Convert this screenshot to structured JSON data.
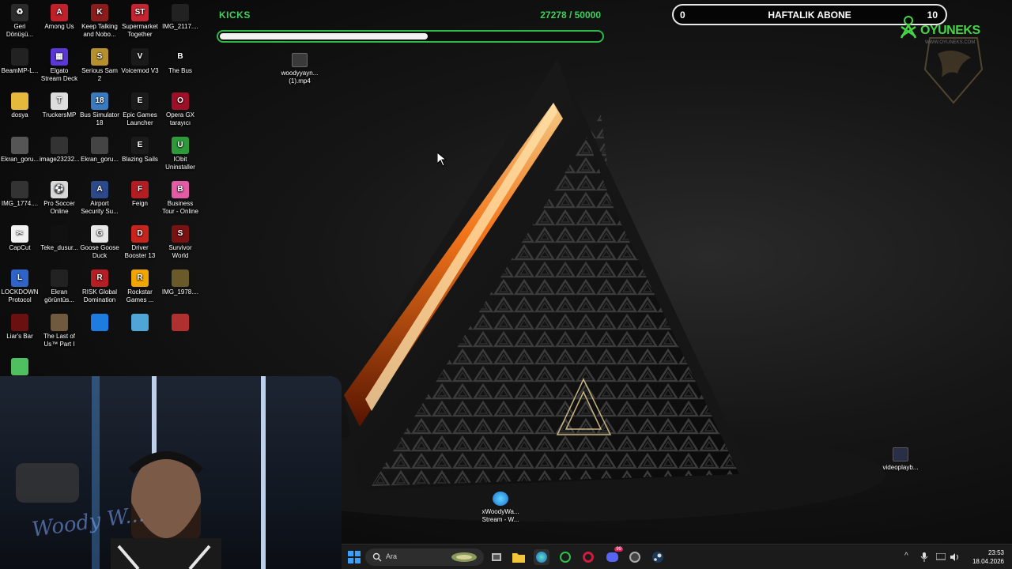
{
  "overlay": {
    "kicks": {
      "title": "KICKS",
      "count": "27278 / 50000",
      "progress": 0.5456
    },
    "subs": {
      "left": "0",
      "title": "HAFTALIK ABONE",
      "right": "10"
    },
    "brand": {
      "name": "OYUNEKS",
      "url": "WWW.OYUNEKS.COM"
    }
  },
  "desktop_icons": [
    {
      "label": "Geri Dönüşü...",
      "color": "#2b2b2b",
      "glyph": "♻"
    },
    {
      "label": "Among Us",
      "color": "#c0202a",
      "glyph": "A"
    },
    {
      "label": "Keep Talking and Nobo...",
      "color": "#8a1c1c",
      "glyph": "K"
    },
    {
      "label": "Supermarket Together",
      "color": "#c52530",
      "glyph": "ST"
    },
    {
      "label": "IMG_2117....",
      "color": "#222",
      "glyph": ""
    },
    {
      "label": "BeamMP-L...",
      "color": "#222",
      "glyph": ""
    },
    {
      "label": "Elgato Stream Deck",
      "color": "#5b38d6",
      "glyph": "▦"
    },
    {
      "label": "Serious Sam 2",
      "color": "#b7902e",
      "glyph": "S"
    },
    {
      "label": "Voicemod V3",
      "color": "#1a1a1a",
      "glyph": "V"
    },
    {
      "label": "The Bus",
      "color": "#0e0e0e",
      "glyph": "B"
    },
    {
      "label": "dosya",
      "color": "#e6b93d",
      "glyph": ""
    },
    {
      "label": "TruckersMP",
      "color": "#ddd",
      "glyph": "T"
    },
    {
      "label": "Bus Simulator 18",
      "color": "#3a7bbf",
      "glyph": "18"
    },
    {
      "label": "Epic Games Launcher",
      "color": "#1b1b1b",
      "glyph": "E"
    },
    {
      "label": "Opera GX tarayıcı",
      "color": "#9d1028",
      "glyph": "O"
    },
    {
      "label": "Ekran_goru...",
      "color": "#555",
      "glyph": ""
    },
    {
      "label": "image23232...",
      "color": "#333",
      "glyph": ""
    },
    {
      "label": "Ekran_goru...",
      "color": "#444",
      "glyph": ""
    },
    {
      "label": "Blazing Sails",
      "color": "#1b1b1b",
      "glyph": "E"
    },
    {
      "label": "IObit Uninstaller",
      "color": "#2d9a3a",
      "glyph": "U"
    },
    {
      "label": "IMG_1774....",
      "color": "#333",
      "glyph": ""
    },
    {
      "label": "Pro Soccer Online",
      "color": "#d8d8d8",
      "glyph": "⚽"
    },
    {
      "label": "Airport Security Su...",
      "color": "#2c4a8a",
      "glyph": "A"
    },
    {
      "label": "Feign",
      "color": "#b41e22",
      "glyph": "F"
    },
    {
      "label": "Business Tour - Online M...",
      "color": "#e35aa5",
      "glyph": "B"
    },
    {
      "label": "CapCut",
      "color": "#f2f2f2",
      "glyph": "✂"
    },
    {
      "label": "Teke_dusur...",
      "color": "#111",
      "glyph": ""
    },
    {
      "label": "Goose Goose Duck",
      "color": "#e8e8e8",
      "glyph": "G"
    },
    {
      "label": "Driver Booster 13",
      "color": "#c8231d",
      "glyph": "D"
    },
    {
      "label": "Survivor World",
      "color": "#7a1212",
      "glyph": "S"
    },
    {
      "label": "LOCKDOWN Protocol",
      "color": "#2f63c7",
      "glyph": "L"
    },
    {
      "label": "Ekran görüntüs...",
      "color": "#222",
      "glyph": ""
    },
    {
      "label": "RISK Global Domination",
      "color": "#b51e24",
      "glyph": "R"
    },
    {
      "label": "Rockstar Games ...",
      "color": "#f0a500",
      "glyph": "R"
    },
    {
      "label": "IMG_1978....",
      "color": "#6a5a2a",
      "glyph": ""
    },
    {
      "label": "Liar's Bar",
      "color": "#6b1010",
      "glyph": ""
    },
    {
      "label": "The Last of Us™ Part I",
      "color": "#6f5a40",
      "glyph": ""
    },
    {
      "label": "",
      "color": "#1e7be0",
      "glyph": ""
    },
    {
      "label": "",
      "color": "#4fa6d6",
      "glyph": ""
    },
    {
      "label": "",
      "color": "#b03030",
      "glyph": ""
    },
    {
      "label": "",
      "color": "#4fbf5f",
      "glyph": ""
    }
  ],
  "files": {
    "woody": "woodyyayn... (1).mp4",
    "videoplay": "videoplayb...",
    "stream": "xWoodyWa... Stream - W..."
  },
  "webcam": {
    "signature": "Woody W..."
  },
  "taskbar": {
    "search_placeholder": "Ara",
    "badge": "99",
    "time": "23:53",
    "date": "18.04.2026"
  }
}
